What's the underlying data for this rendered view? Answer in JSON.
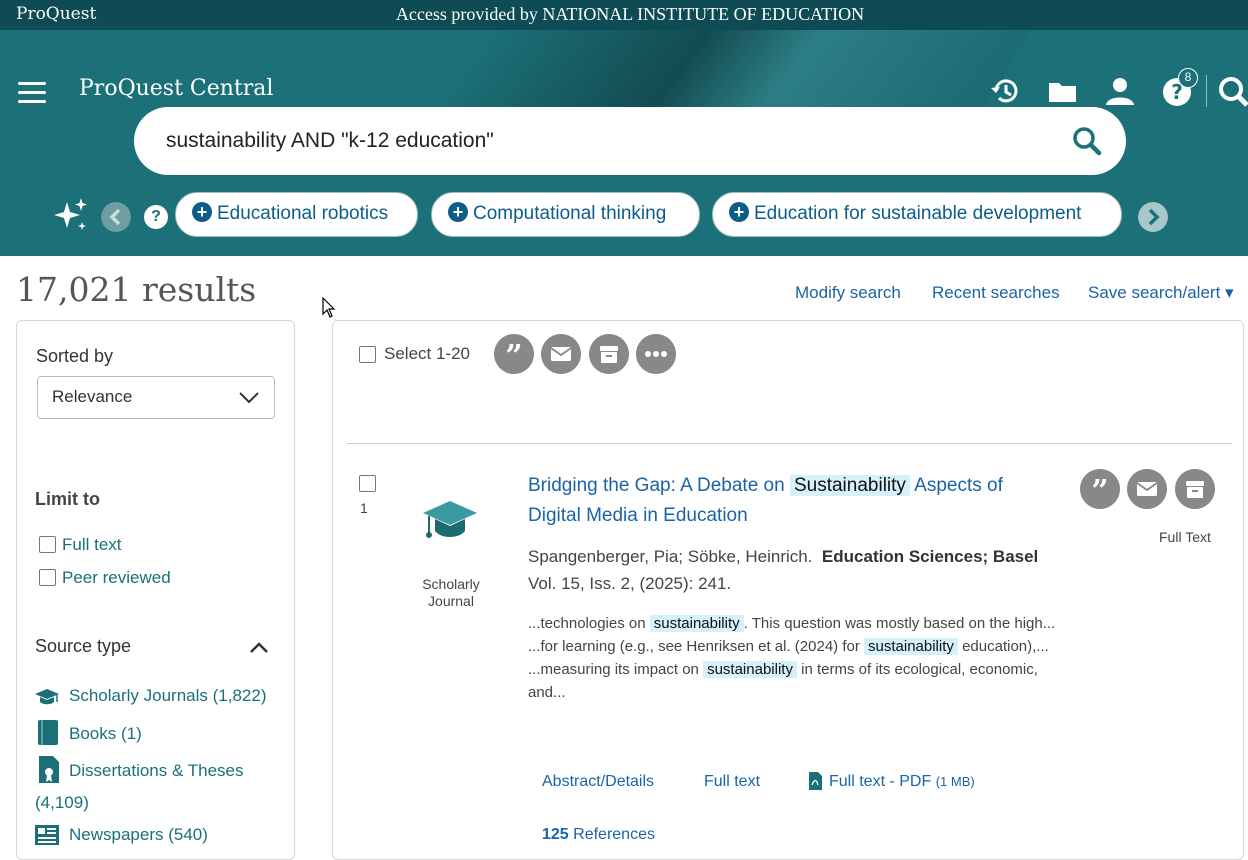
{
  "topbar": {
    "brand": "ProQuest",
    "access": "Access provided by NATIONAL INSTITUTE OF EDUCATION"
  },
  "header": {
    "app_title": "ProQuest Central",
    "help_badge": "8",
    "search_query": "sustainability AND \"k-12 education\"",
    "help_glyph": "?",
    "chips": [
      {
        "label": "Educational robotics"
      },
      {
        "label": "Computational thinking"
      },
      {
        "label": "Education for sustainable development"
      }
    ]
  },
  "results": {
    "count": "17,021 results",
    "links": [
      "Modify search",
      "Recent searches",
      "Save search/alert ▾"
    ]
  },
  "sidebar": {
    "sorted_by_label": "Sorted by",
    "sort_value": "Relevance",
    "limit_to_label": "Limit to",
    "limits": [
      "Full text",
      "Peer reviewed"
    ],
    "source_type_label": "Source type",
    "sources": [
      {
        "label": "Scholarly Journals (1,822)",
        "icon": "graduation-cap-icon"
      },
      {
        "label": "Books (1)",
        "icon": "book-icon"
      },
      {
        "label": "Dissertations & Theses",
        "label2": "(4,109)",
        "icon": "certificate-icon"
      },
      {
        "label": "Newspapers (540)",
        "icon": "newspaper-icon"
      }
    ]
  },
  "list": {
    "select_label": "Select 1-20",
    "item": {
      "number": "1",
      "type_line1": "Scholarly",
      "type_line2": "Journal",
      "title_pre": "Bridging the Gap: A Debate on",
      "title_hl": "Sustainability",
      "title_post": "Aspects of Digital Media in Education",
      "authors": "Spangenberger, Pia; Söbke, Heinrich.",
      "journal": "Education Sciences; Basel",
      "citation": "Vol. 15, Iss. 2,  (2025): 241.",
      "snippets": [
        {
          "pre": "...technologies on",
          "hl": "sustainability",
          "post": ". This question was mostly based on the high..."
        },
        {
          "pre": "...for learning (e.g., see Henriksen et al. (2024) for",
          "hl": "sustainability",
          "post": "education),..."
        },
        {
          "pre": "...measuring its impact on",
          "hl": "sustainability",
          "post": "in terms of its ecological, economic, and..."
        }
      ],
      "full_text_tag": "Full Text",
      "links": {
        "abstract": "Abstract/Details",
        "full_text": "Full text",
        "pdf": "Full text - PDF",
        "pdf_size": "(1 MB)",
        "refs_count": "125",
        "refs_label": "References"
      }
    }
  },
  "colors": {
    "header": "#1c7178",
    "topbar": "#0f4b55",
    "link": "#1a63a8",
    "teal_link": "#1b7078",
    "highlight": "#d7f1fb"
  }
}
